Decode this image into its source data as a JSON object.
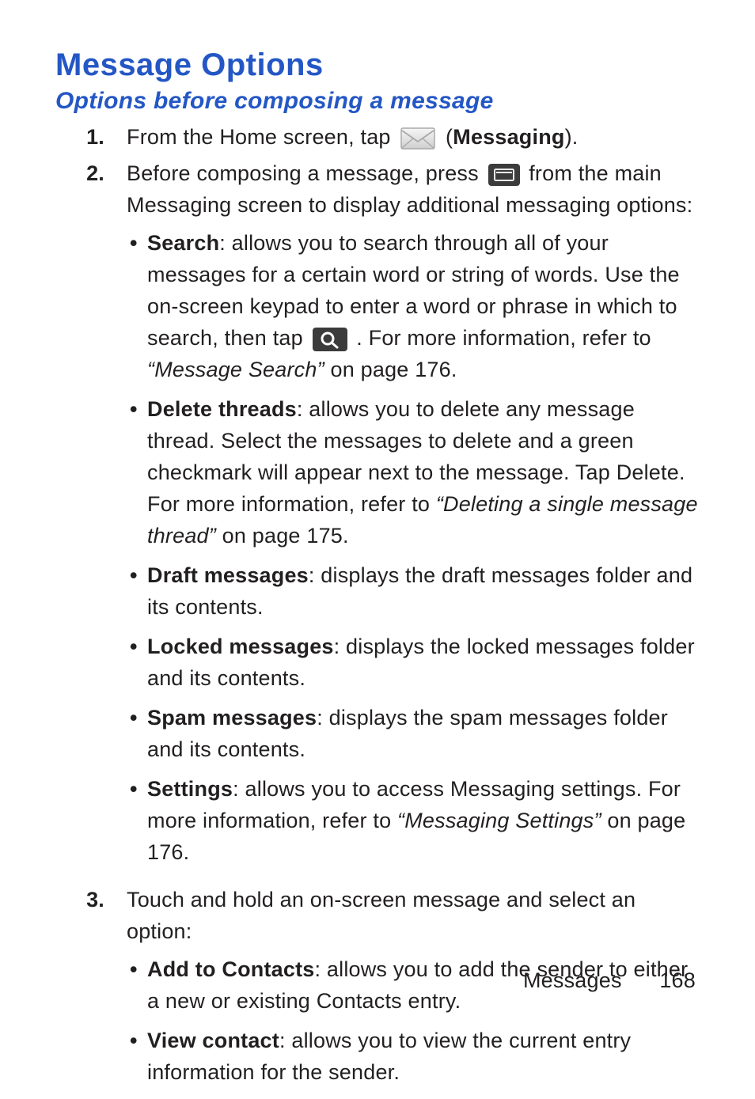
{
  "heading": "Message Options",
  "subheading": "Options before composing a message",
  "steps": {
    "s1": {
      "num": "1.",
      "pre": "From the Home screen, tap ",
      "post_open": " (",
      "app": "Messaging",
      "post_close": ")."
    },
    "s2": {
      "num": "2.",
      "pre": "Before composing a message, press ",
      "post": " from the main Messaging screen to display additional messaging options:"
    },
    "s3": {
      "num": "3.",
      "text": "Touch and hold an on-screen message and select an option:"
    }
  },
  "bullets2": {
    "search": {
      "term": "Search",
      "desc1": ": allows you to search through all of your messages for a certain word or string of words. Use the on-screen keypad to enter a word or phrase in which to search, then tap ",
      "desc2": " . For more information, refer to ",
      "ref": "“Message Search”",
      "page": "  on page 176."
    },
    "delete": {
      "term": "Delete threads",
      "desc1": ": allows you to delete any message thread. Select the messages to delete and a green checkmark will appear next to the message. Tap Delete. For more information, refer to ",
      "ref": "“Deleting a single message thread”",
      "page": "  on page 175."
    },
    "draft": {
      "term": "Draft messages",
      "desc": ": displays the draft messages folder and its contents."
    },
    "locked": {
      "term": "Locked messages",
      "desc": ": displays the locked messages folder and its contents."
    },
    "spam": {
      "term": "Spam messages",
      "desc": ": displays the spam messages folder and its contents."
    },
    "settings": {
      "term": "Settings",
      "desc1": ": allows you to access Messaging settings. For more information, refer to ",
      "ref": "“Messaging Settings”",
      "page": "  on page 176."
    }
  },
  "bullets3": {
    "addcontacts": {
      "term": "Add to Contacts",
      "desc": ": allows you to add the sender to either a new or existing Contacts entry."
    },
    "viewcontact": {
      "term": "View contact",
      "desc": ": allows you to view the current entry information for the sender."
    }
  },
  "footer": {
    "label": "Messages",
    "page": "168"
  }
}
